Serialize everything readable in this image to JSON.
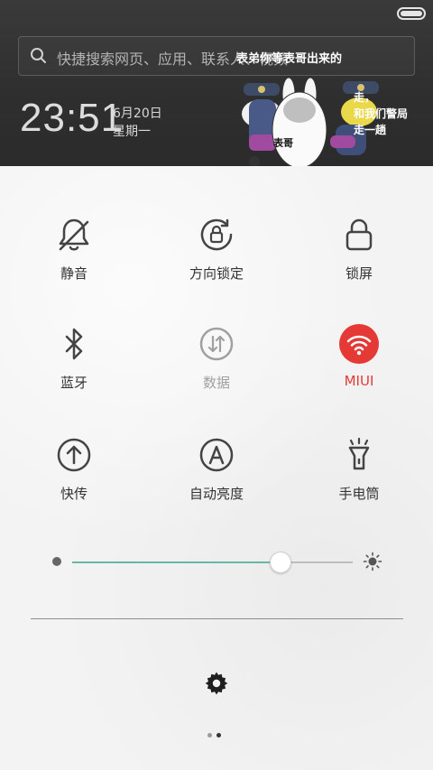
{
  "status_bar": {
    "battery_icon": "battery-full-icon"
  },
  "header": {
    "search_placeholder": "快捷搜索网页、应用、联系人、视频",
    "time": "23:51",
    "date": "6月20日",
    "weekday": "星期一",
    "sticker": {
      "caption_top": "表弟你等表哥出来的",
      "caption_side_line1": "走，",
      "caption_side_line2": "和我们警局",
      "caption_side_line3": "走一趟",
      "label": "表哥"
    }
  },
  "toggles": [
    {
      "label": "静音",
      "icon": "bell-off-icon",
      "state": "off"
    },
    {
      "label": "方向锁定",
      "icon": "rotation-lock-icon",
      "state": "off"
    },
    {
      "label": "锁屏",
      "icon": "lock-icon",
      "state": "off"
    },
    {
      "label": "蓝牙",
      "icon": "bluetooth-icon",
      "state": "off"
    },
    {
      "label": "数据",
      "icon": "mobile-data-icon",
      "state": "disabled"
    },
    {
      "label": "MIUI",
      "icon": "wifi-icon",
      "state": "on"
    },
    {
      "label": "快传",
      "icon": "share-upload-icon",
      "state": "off"
    },
    {
      "label": "自动亮度",
      "icon": "auto-brightness-icon",
      "state": "off"
    },
    {
      "label": "手电筒",
      "icon": "flashlight-icon",
      "state": "off"
    }
  ],
  "brightness": {
    "level": 0.74
  },
  "colors": {
    "accent_on": "#e53935",
    "slider_fill": "#66b8a3",
    "icon": "#444444",
    "disabled": "#a0a0a0"
  },
  "pager": {
    "pages": 2,
    "current": 2
  }
}
